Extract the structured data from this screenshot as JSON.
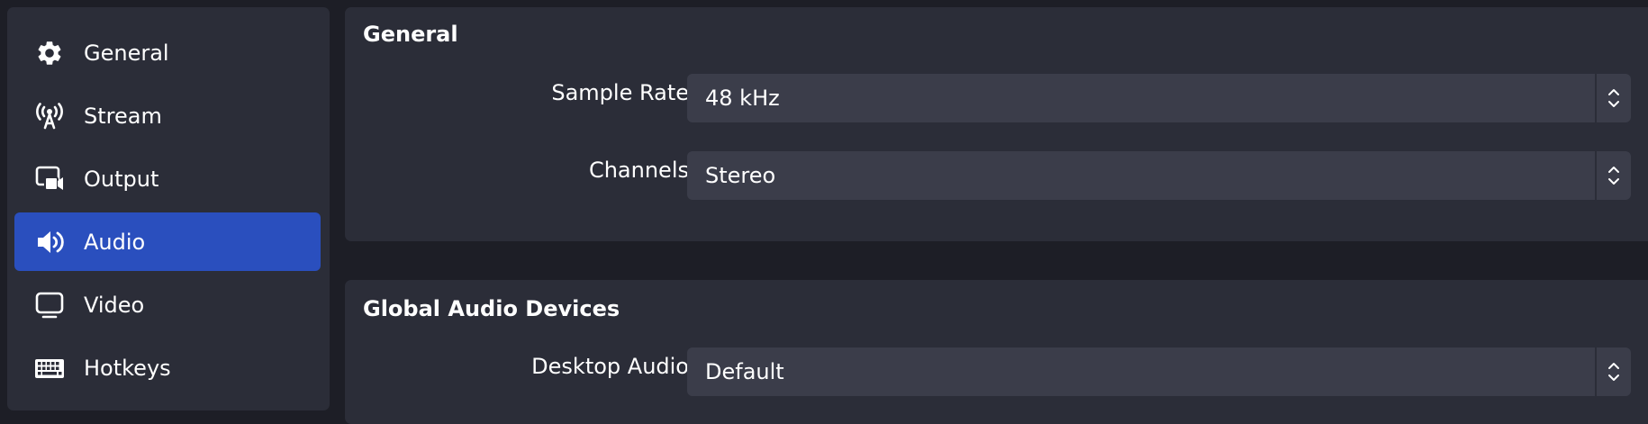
{
  "sidebar": {
    "items": [
      {
        "label": "General",
        "icon": "gear-icon"
      },
      {
        "label": "Stream",
        "icon": "antenna-icon"
      },
      {
        "label": "Output",
        "icon": "output-icon"
      },
      {
        "label": "Audio",
        "icon": "speaker-icon",
        "active": true
      },
      {
        "label": "Video",
        "icon": "monitor-icon"
      },
      {
        "label": "Hotkeys",
        "icon": "keyboard-icon"
      }
    ]
  },
  "sections": {
    "general": {
      "title": "General",
      "sample_rate": {
        "label": "Sample Rate",
        "value": "48 kHz"
      },
      "channels": {
        "label": "Channels",
        "value": "Stereo"
      }
    },
    "global_audio": {
      "title": "Global Audio Devices",
      "desktop_audio": {
        "label": "Desktop Audio",
        "value": "Default"
      }
    }
  },
  "colors": {
    "accent": "#2a4fbe",
    "panel": "#2b2d38",
    "background": "#1d1e26",
    "field": "#3b3d4a"
  }
}
